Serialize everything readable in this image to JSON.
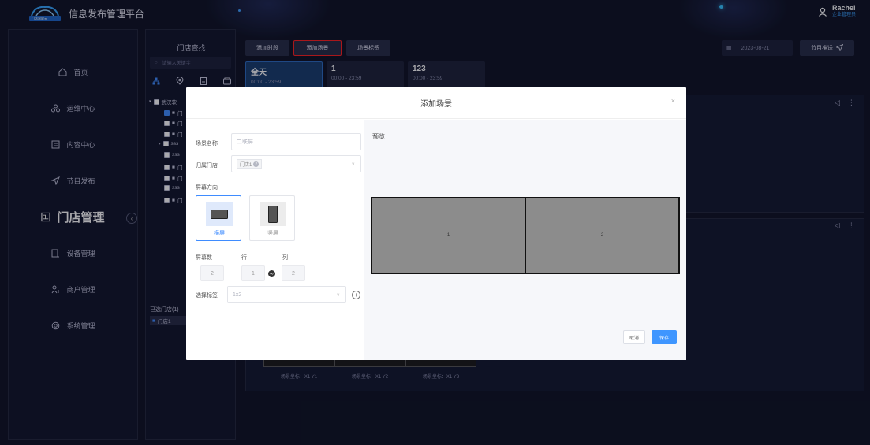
{
  "app": {
    "title": "信息发布管理平台",
    "logo_text": "门店易屏云"
  },
  "user": {
    "name": "Rachel",
    "role": "企业管理员"
  },
  "sidebar": {
    "items": [
      {
        "label": "首页",
        "icon": "home-icon"
      },
      {
        "label": "运维中心",
        "icon": "ops-icon"
      },
      {
        "label": "内容中心",
        "icon": "content-icon"
      },
      {
        "label": "节目发布",
        "icon": "send-icon"
      },
      {
        "label": "门店管理",
        "icon": "store-icon"
      },
      {
        "label": "设备管理",
        "icon": "device-icon"
      },
      {
        "label": "商户管理",
        "icon": "merchant-icon"
      },
      {
        "label": "系统管理",
        "icon": "settings-icon"
      }
    ],
    "active": "门店管理"
  },
  "store_panel": {
    "title": "门店查找",
    "search_placeholder": "请输入关键字",
    "tree": [
      {
        "label": "武汉软",
        "checked": false
      },
      {
        "label": "门",
        "checked": true
      },
      {
        "label": "门",
        "checked": false
      },
      {
        "label": "门",
        "checked": false
      },
      {
        "label": "sss",
        "checked": false
      },
      {
        "label": "sss",
        "checked": false
      },
      {
        "label": "门",
        "checked": false
      },
      {
        "label": "门",
        "checked": false
      },
      {
        "label": "sss",
        "checked": false
      },
      {
        "label": "门",
        "checked": false
      }
    ],
    "selected_label": "已选门店(1)",
    "selected_item": "门店1"
  },
  "toolbar": {
    "add_period": "添加时段",
    "add_scene": "添加场景",
    "scene_tag": "场景标签",
    "date": "2023-08-21",
    "push": "节目推送"
  },
  "periods": [
    {
      "name": "全天",
      "time": "00:00 - 23:59"
    },
    {
      "name": "1",
      "time": "00:00 - 23:59"
    },
    {
      "name": "123",
      "time": "00:00 - 23:59"
    }
  ],
  "scene_coords": [
    "场景坐标：X1 Y1",
    "场景坐标：X1 Y2",
    "场景坐标：X1 Y3"
  ],
  "modal": {
    "title": "添加场景",
    "close": "×",
    "scene_name_label": "场景名称",
    "scene_name_placeholder": "二联屏",
    "store_label": "归属门店",
    "store_tag": "门店1",
    "orientation_label": "屏幕方向",
    "landscape": "横屏",
    "portrait": "竖屏",
    "screen_count_label": "屏幕数",
    "row_label": "行",
    "col_label": "列",
    "screen_count": "2",
    "rows": "1",
    "cols": "2",
    "tag_label": "选择标签",
    "tag_value": "1x2",
    "preview_label": "预览",
    "screens": [
      "1",
      "2"
    ],
    "cancel": "取消",
    "save": "保存"
  }
}
